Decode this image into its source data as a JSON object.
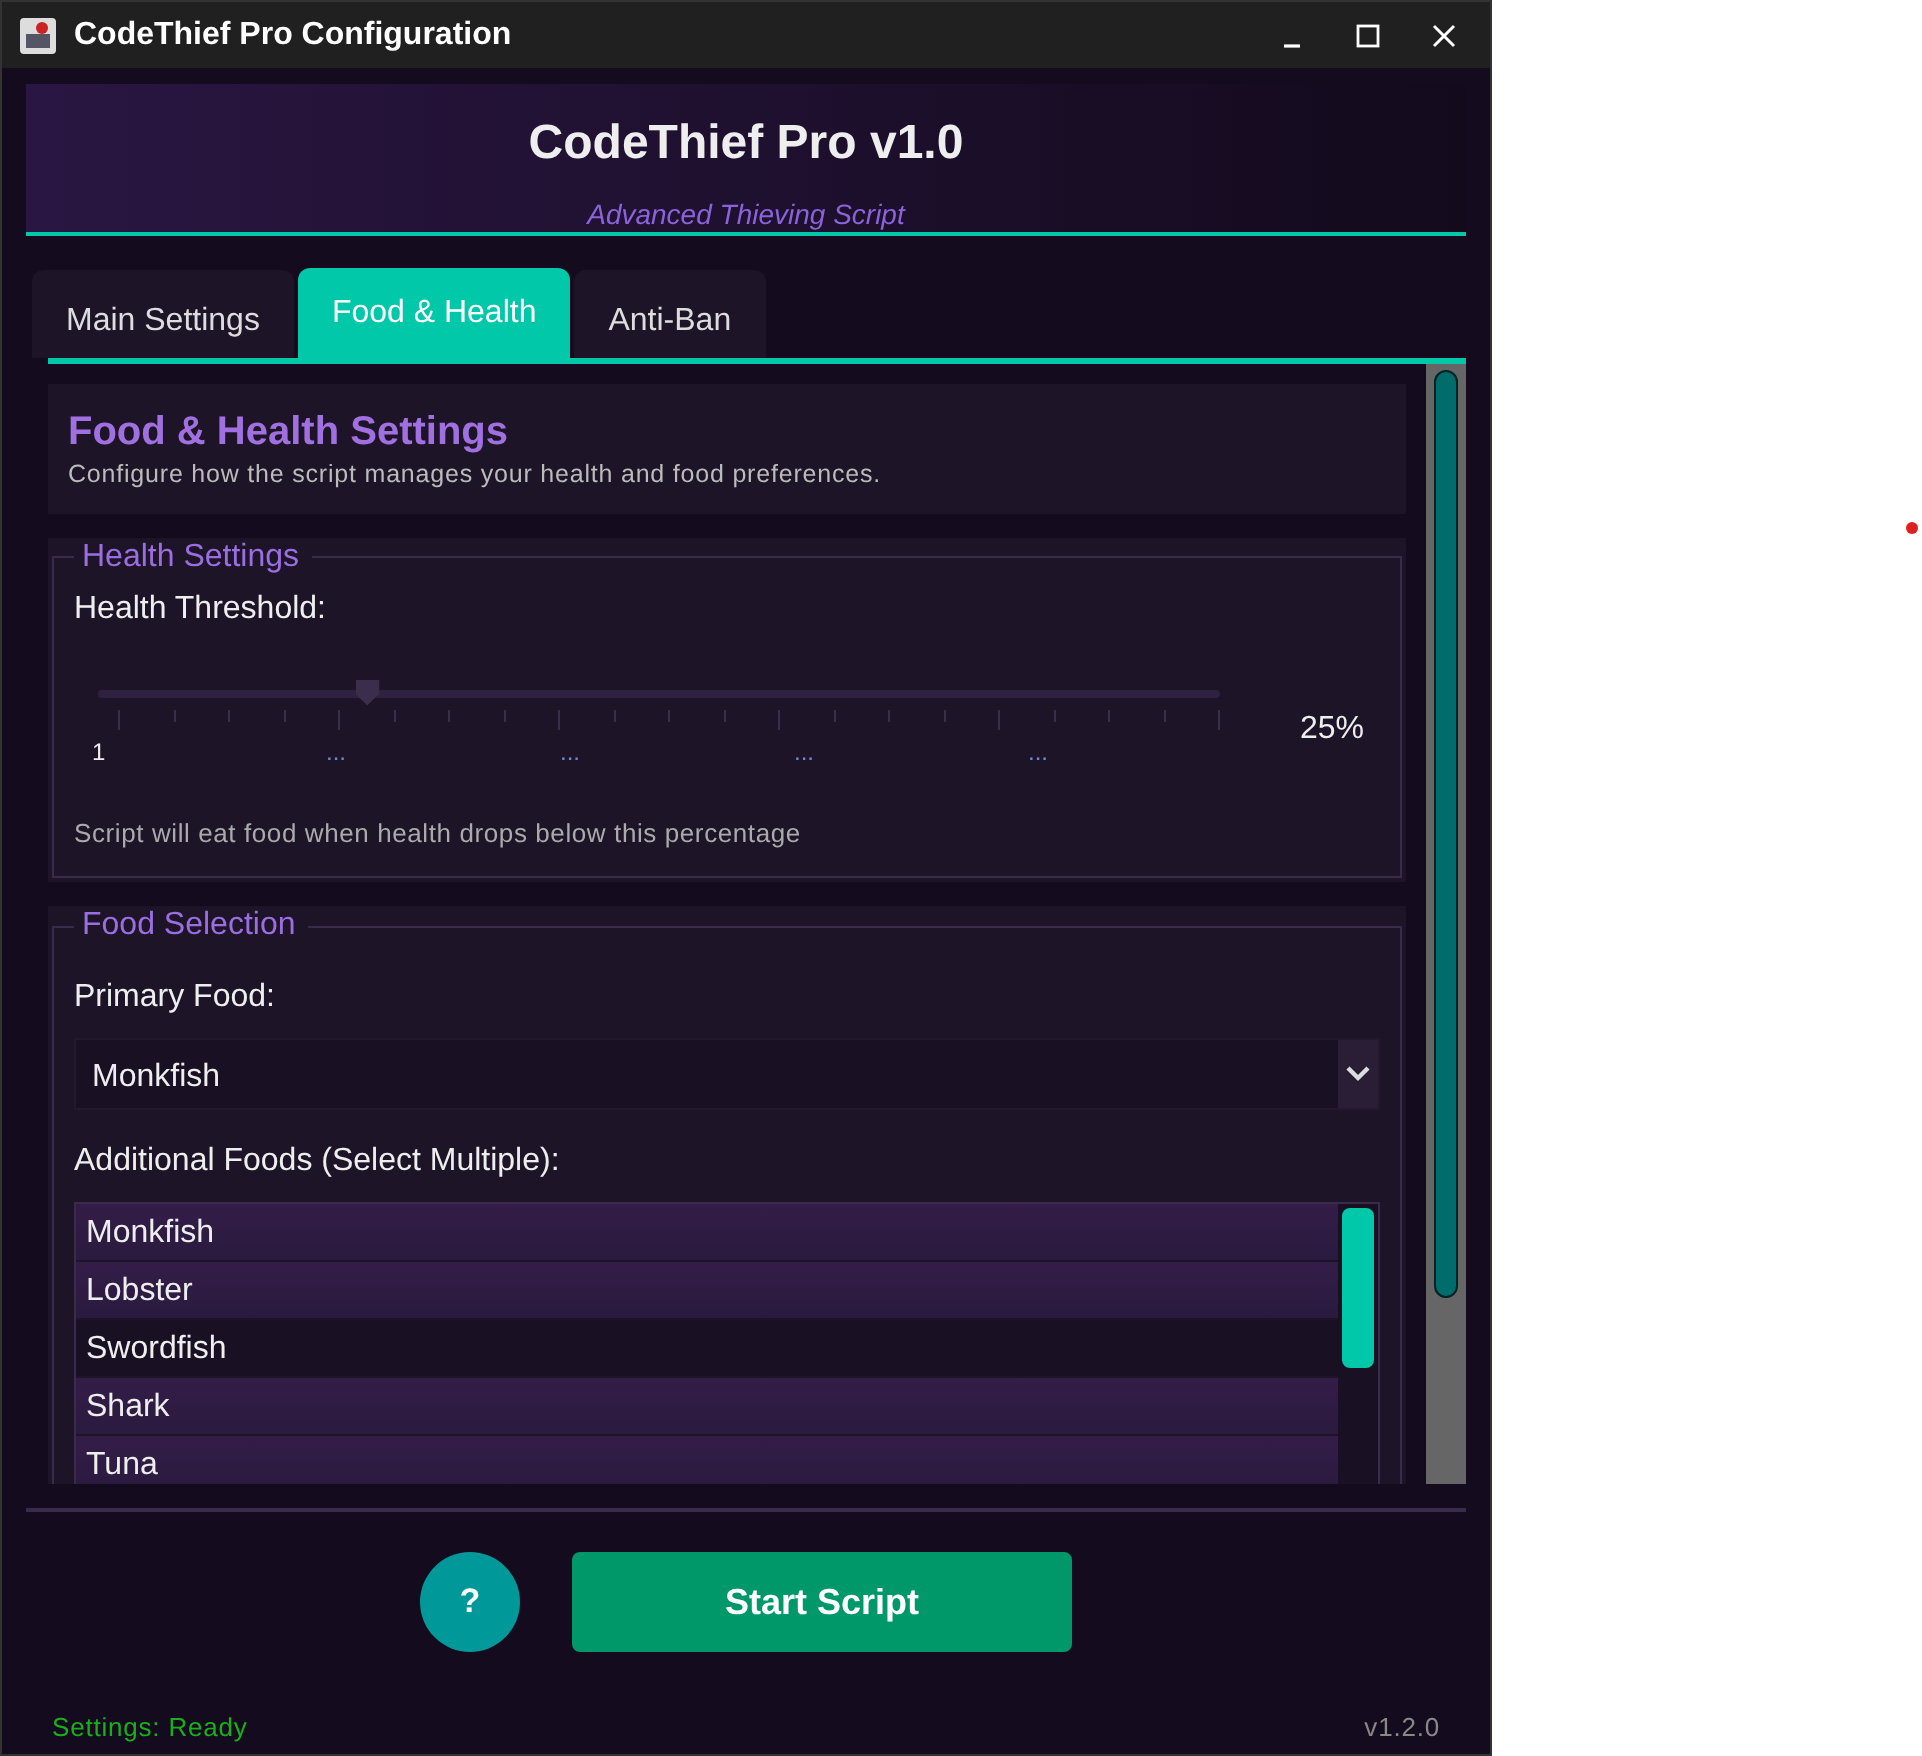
{
  "window": {
    "title": "CodeThief Pro Configuration"
  },
  "header": {
    "title": "CodeThief Pro v1.0",
    "subtitle": "Advanced Thieving Script"
  },
  "tabs": [
    {
      "label": "Main Settings",
      "selected": false
    },
    {
      "label": "Food & Health",
      "selected": true
    },
    {
      "label": "Anti-Ban",
      "selected": false
    }
  ],
  "section": {
    "title": "Food & Health Settings",
    "description": "Configure how the script manages your health and food preferences."
  },
  "health": {
    "legend": "Health Settings",
    "label": "Health Threshold:",
    "slider": {
      "level": 0.24,
      "tick_labels": [
        "1",
        "...",
        "...",
        "...",
        "..."
      ],
      "reading": "25%"
    },
    "hint": "Script will eat food when health drops below this percentage"
  },
  "food": {
    "legend": "Food Selection",
    "primary_label": "Primary Food:",
    "primary_value": "Monkfish",
    "additional_label": "Additional Foods (Select Multiple):",
    "items": [
      {
        "label": "Monkfish",
        "selected": true
      },
      {
        "label": "Lobster",
        "selected": true
      },
      {
        "label": "Swordfish",
        "selected": false
      },
      {
        "label": "Shark",
        "selected": true
      },
      {
        "label": "Tuna",
        "selected": true
      }
    ]
  },
  "buttons": {
    "help": "?",
    "start": "Start Script"
  },
  "status_bar": {
    "status": "Settings: Ready",
    "version": "v1.2.0"
  }
}
